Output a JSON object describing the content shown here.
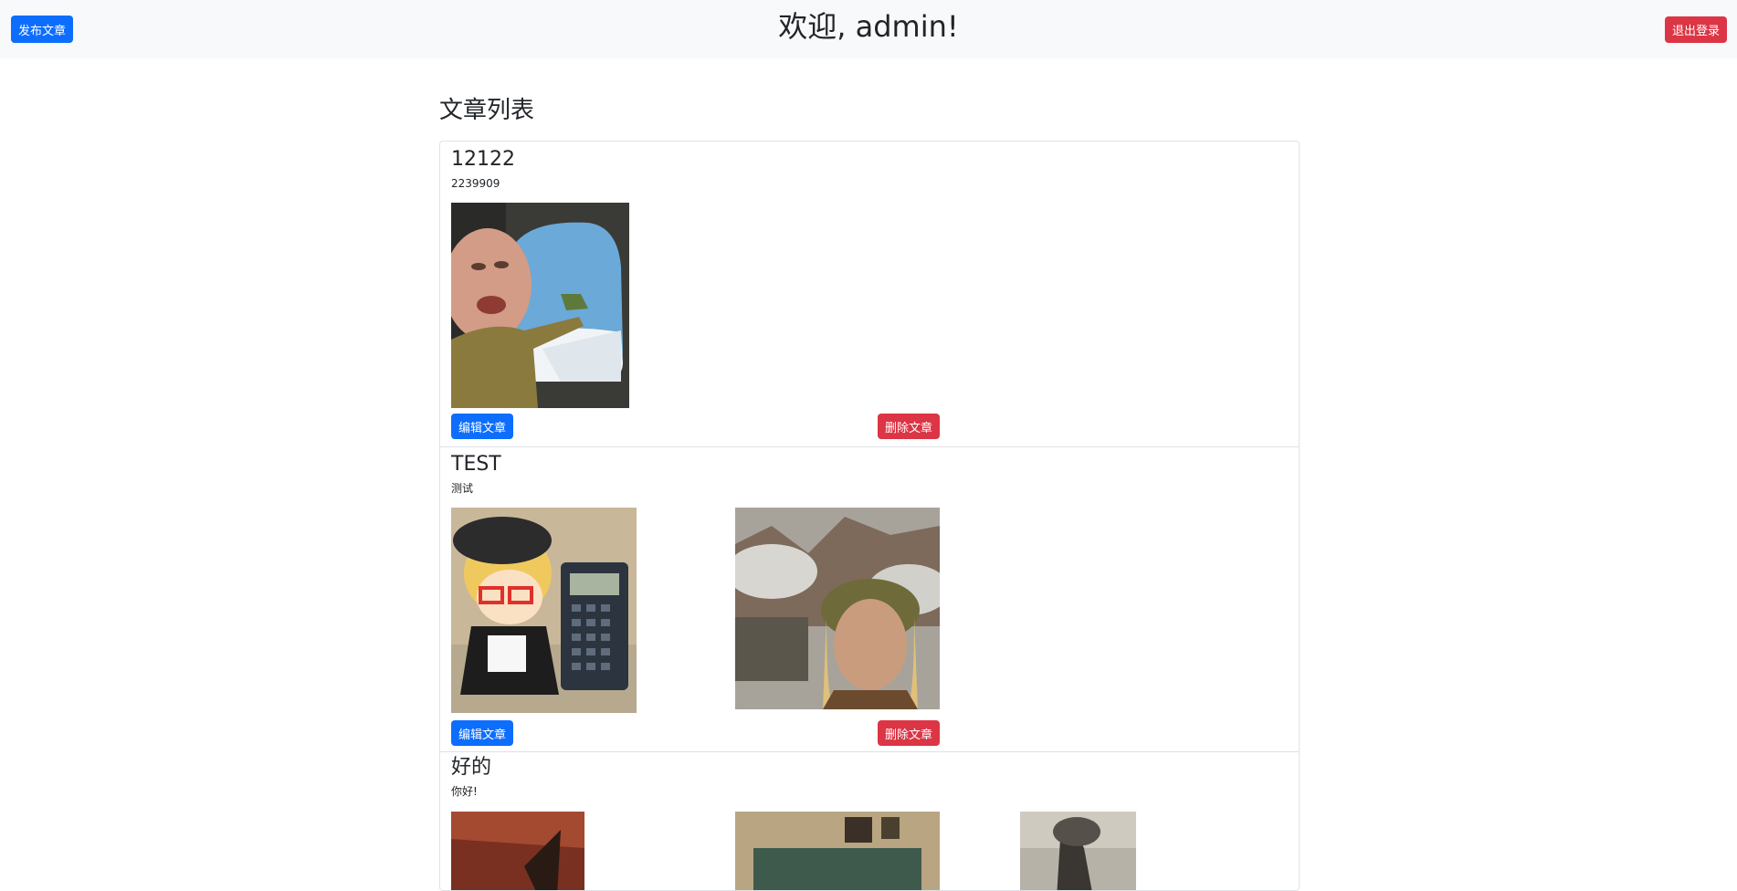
{
  "header": {
    "publish_label": "发布文章",
    "welcome_text": "欢迎, admin!",
    "logout_label": "退出登录"
  },
  "main": {
    "title": "文章列表",
    "articles": [
      {
        "title": "12122",
        "content": "2239909",
        "edit_label": "编辑文章",
        "delete_label": "删除文章"
      },
      {
        "title": "TEST",
        "content": "测试",
        "edit_label": "编辑文章",
        "delete_label": "删除文章"
      },
      {
        "title": "好的",
        "content": "你好!"
      }
    ]
  },
  "colors": {
    "primary": "#0d6efd",
    "danger": "#dc3545",
    "topbar": "#f8f9fa",
    "border": "#dee2e6"
  }
}
